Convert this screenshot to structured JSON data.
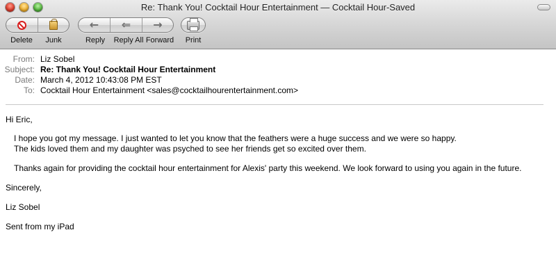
{
  "window": {
    "title": "Re: Thank You! Cocktail Hour Entertainment — Cocktail Hour-Saved"
  },
  "toolbar": {
    "delete_label": "Delete",
    "junk_label": "Junk",
    "reply_label": "Reply",
    "reply_all_label": "Reply All",
    "forward_label": "Forward",
    "print_label": "Print"
  },
  "icons": {
    "delete": "delete-circle-icon",
    "junk": "junk-bag-icon",
    "reply": "reply-arrow-icon",
    "reply_all": "reply-all-arrow-icon",
    "forward": "forward-arrow-icon",
    "print": "printer-icon"
  },
  "headers": {
    "from_label": "From:",
    "from_value": "Liz Sobel",
    "subject_label": "Subject:",
    "subject_value": "Re: Thank You! Cocktail Hour Entertainment",
    "date_label": "Date:",
    "date_value": "March 4, 2012 10:43:08 PM EST",
    "to_label": "To:",
    "to_value": "Cocktail Hour Entertainment <sales@cocktailhourentertainment.com>"
  },
  "body": {
    "greeting": "Hi Eric,",
    "para1_line1": "  I hope you got my message. I just wanted to let you know that the feathers were a huge success and we were so happy.",
    "para1_line2": "The kids loved them and my daughter was psyched to see her friends get so excited over them.",
    "para2": "Thanks again for providing the cocktail hour entertainment for Alexis' party this weekend. We look forward to using you again in the future.",
    "closing": "Sincerely,",
    "signature": "Liz Sobel",
    "footer": "Sent from my iPad"
  },
  "colors": {
    "delete_red": "#d81e1e",
    "header_label_gray": "#7a7a7a",
    "divider": "#c8c8c8"
  }
}
